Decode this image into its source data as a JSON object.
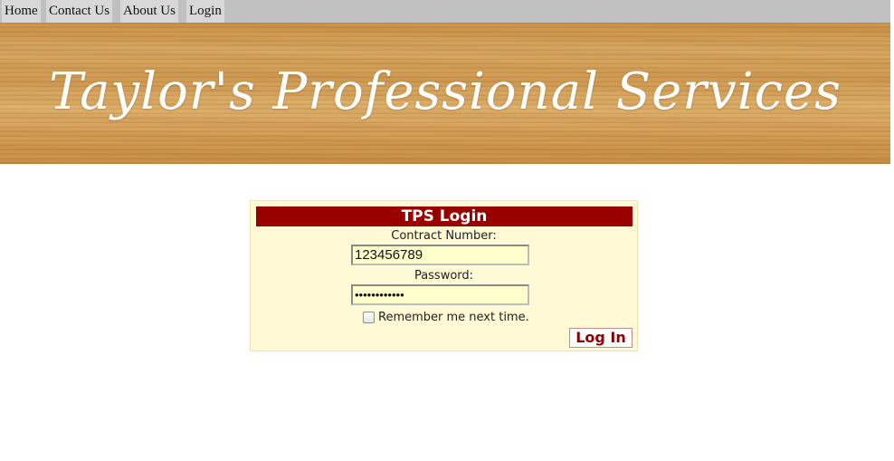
{
  "nav": {
    "items": [
      {
        "label": "Home"
      },
      {
        "label": "Contact Us"
      },
      {
        "label": "About Us"
      },
      {
        "label": "Login"
      }
    ]
  },
  "banner": {
    "title": "Taylor's Professional Services"
  },
  "login": {
    "header": "TPS Login",
    "contract_label": "Contract Number:",
    "contract_value": "123456789",
    "password_label": "Password:",
    "password_value": "••••••••••••",
    "remember_label": "Remember me next time.",
    "remember_checked": false,
    "submit_label": "Log In"
  },
  "colors": {
    "nav_background": "#c0c0c0",
    "header_background": "#990000",
    "box_background": "#fff9d6",
    "input_background": "#ffffcc",
    "button_text": "#8b0000"
  }
}
